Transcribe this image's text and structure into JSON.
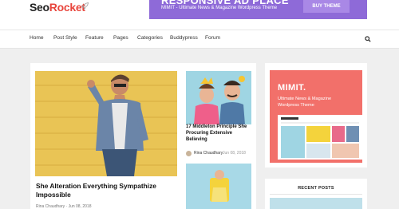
{
  "header": {
    "logo_part1": "Seo",
    "logo_part2": "Rocket",
    "ad_title": "RESPONSIVE AD PLACE",
    "ad_subtitle": "MIMIT - Ultimate News & Magazine Wordpress Theme",
    "ad_button": "BUY THEME"
  },
  "nav": {
    "items": [
      "Home",
      "Post Style",
      "Feature",
      "Pages",
      "Categories",
      "Buddypress",
      "Forum"
    ]
  },
  "featured": {
    "title": "She Alteration Everything Sympathize Impossible",
    "meta": "Rina Chaudhary  ·  Jun 08, 2018"
  },
  "side_post": {
    "title": "17 Middleton Principle She Procuring Extensive Believing",
    "author": "Rina Chaudhary",
    "date": "Jun 08, 2018"
  },
  "sidebar_ad": {
    "title": "MIMIT.",
    "text": "Ultimate News & Magazine Wordpress Theme"
  },
  "recent": {
    "title": "RECENT POSTS"
  },
  "colors": {
    "brand_red": "#e8453c",
    "ad_purple": "#8e6ad8",
    "sidebar_coral": "#f2706a"
  }
}
